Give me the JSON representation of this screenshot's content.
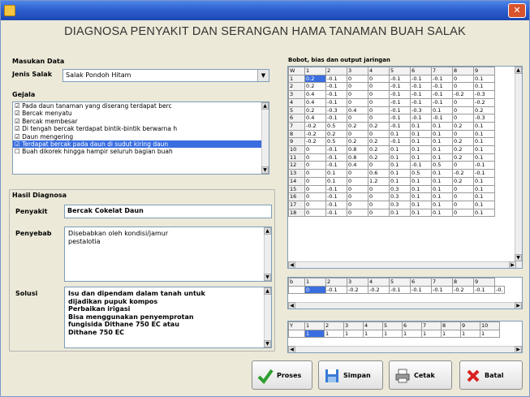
{
  "window": {
    "title": ""
  },
  "app_title": "DIAGNOSA PENYAKIT DAN SERANGAN HAMA TANAMAN BUAH SALAK",
  "input_section": {
    "header": "Masukan Data",
    "jenis_label": "Jenis Salak",
    "jenis_value": "Salak Pondoh Hitam",
    "gejala_label": "Gejala",
    "symptoms": [
      "Pada daun tanaman yang diserang terdapat berc",
      "Bercak menyatu",
      "Bercak membesar",
      "Di tengah bercak terdapat bintik-bintik berwarna h",
      "Daun mengering",
      "Terdapat bercak pada daun di sudut kiring daun",
      "Buah dikorek hingga hampir seluruh bagian buah"
    ],
    "selected_symptom": 5
  },
  "result_section": {
    "header": "Hasil Diagnosa",
    "penyakit_label": "Penyakit",
    "penyakit_value": "Bercak Cokelat Daun",
    "penyebab_label": "Penyebab",
    "penyebab_lines": [
      "Disebabkan oleh kondisi/jamur",
      "pestalotia"
    ],
    "solusi_label": "Solusi",
    "solusi_lines": [
      "Isu dan dipendam dalam tanah untuk",
      "dijadikan pupuk kompos",
      "Perbaikan irigasi",
      "Bisa menggunakan penyemprotan",
      "fungisida Dithane 750 EC atau",
      "Dithane 750 EC"
    ]
  },
  "matrix_label": "Bobot, bias dan output jaringan",
  "weight_grid": {
    "header": [
      "W",
      "1",
      "2",
      "3",
      "4",
      "5",
      "6",
      "7",
      "8",
      "9"
    ],
    "rows": [
      [
        "1",
        "0.2",
        "-0.1",
        "0",
        "0",
        "-0.1",
        "-0.1",
        "-0.1",
        "0",
        "0.1"
      ],
      [
        "2",
        "0.2",
        "-0.1",
        "0",
        "0",
        "-0.1",
        "-0.1",
        "-0.1",
        "0",
        "0.1"
      ],
      [
        "3",
        "0.4",
        "-0.1",
        "0",
        "0",
        "-0.1",
        "-0.1",
        "-0.1",
        "-0.2",
        "-0.3"
      ],
      [
        "4",
        "0.4",
        "-0.1",
        "0",
        "0",
        "-0.1",
        "-0.1",
        "-0.1",
        "0",
        "-0.2"
      ],
      [
        "5",
        "0.2",
        "-0.3",
        "0.4",
        "0",
        "-0.1",
        "-0.3",
        "0.1",
        "0",
        "0.2"
      ],
      [
        "6",
        "0.4",
        "-0.1",
        "0",
        "0",
        "-0.1",
        "-0.1",
        "-0.1",
        "0",
        "-0.3"
      ],
      [
        "7",
        "-0.2",
        "0.5",
        "0.2",
        "0.2",
        "-0.1",
        "0.1",
        "0.1",
        "0.2",
        "0.1"
      ],
      [
        "8",
        "-0.2",
        "0.2",
        "0",
        "0",
        "0.1",
        "0.1",
        "0.1",
        "0",
        "0.1"
      ],
      [
        "9",
        "-0.2",
        "0.5",
        "0.2",
        "0.2",
        "-0.1",
        "0.1",
        "0.1",
        "0.2",
        "0.1"
      ],
      [
        "10",
        "0",
        "-0.1",
        "0.8",
        "0.2",
        "0.1",
        "0.1",
        "0.1",
        "0.2",
        "0.1"
      ],
      [
        "11",
        "0",
        "-0.1",
        "0.8",
        "0.2",
        "0.1",
        "0.1",
        "0.1",
        "0.2",
        "0.1"
      ],
      [
        "12",
        "0",
        "-0.1",
        "0.4",
        "0",
        "0.1",
        "-0.1",
        "0.5",
        "0",
        "-0.1"
      ],
      [
        "13",
        "0",
        "0.1",
        "0",
        "0.6",
        "0.1",
        "0.5",
        "0.1",
        "-0.2",
        "-0.1"
      ],
      [
        "14",
        "0",
        "0.1",
        "0",
        "1.2",
        "0.1",
        "0.1",
        "0.1",
        "0.2",
        "0.1"
      ],
      [
        "15",
        "0",
        "-0.1",
        "0",
        "0",
        "0.3",
        "0.1",
        "0.1",
        "0",
        "0.1"
      ],
      [
        "16",
        "0",
        "-0.1",
        "0",
        "0",
        "0.3",
        "0.1",
        "0.1",
        "0",
        "0.1"
      ],
      [
        "17",
        "0",
        "-0.1",
        "0",
        "0",
        "0.3",
        "0.1",
        "0.1",
        "0",
        "0.1"
      ],
      [
        "18",
        "0",
        "-0.1",
        "0",
        "0",
        "0.1",
        "0.1",
        "0.1",
        "0",
        "0.1"
      ]
    ]
  },
  "bias_grid": {
    "header": [
      "b",
      "1",
      "2",
      "3",
      "4",
      "5",
      "6",
      "7",
      "8",
      "9"
    ],
    "values": [
      "",
      "0",
      "-0.1",
      "-0.2",
      "-0.2",
      "-0.1",
      "-0.1",
      "-0.1",
      "-0.2",
      "-0.1",
      "-0."
    ]
  },
  "output_grid": {
    "header": [
      "Y",
      "1",
      "2",
      "3",
      "4",
      "5",
      "6",
      "7",
      "8",
      "9",
      "10"
    ],
    "values": [
      "",
      "1",
      "1",
      "1",
      "1",
      "1",
      "1",
      "1",
      "1",
      "1",
      "1"
    ]
  },
  "buttons": {
    "proses": "Proses",
    "simpan": "Simpan",
    "cetak": "Cetak",
    "batal": "Batal"
  },
  "colors": {
    "selection": "#3a6ee0",
    "title_bar": "#2e5fcf",
    "batal_icon": "#d92020",
    "proses_icon": "#2e9e2e"
  }
}
